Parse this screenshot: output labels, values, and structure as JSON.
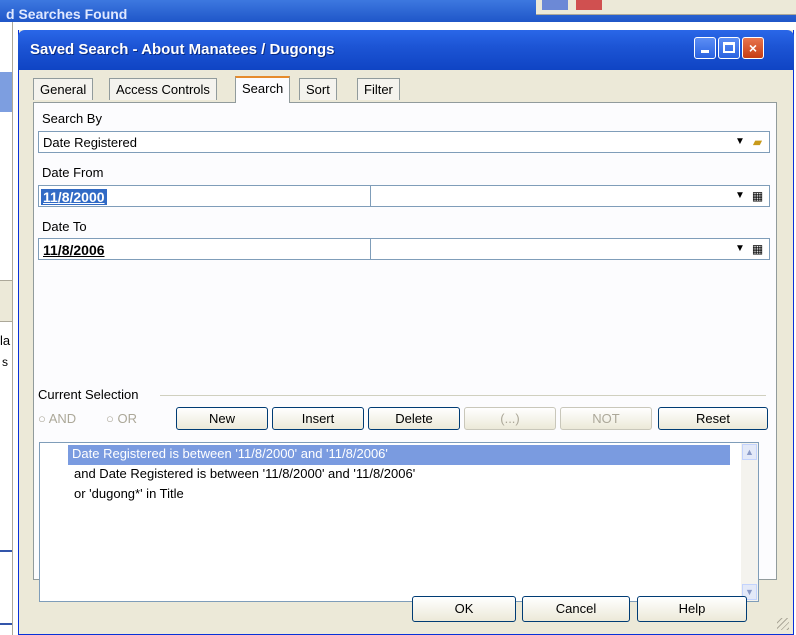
{
  "background": {
    "title_fragment": "d Searches Found",
    "left_text_1": "la",
    "left_text_2": "s"
  },
  "dialog": {
    "title": "Saved Search - About Manatees / Dugongs",
    "window_buttons": {
      "minimize": "minimize",
      "maximize": "maximize",
      "close": "×"
    }
  },
  "tabs": [
    "General",
    "Access Controls",
    "Search",
    "Sort",
    "Filter"
  ],
  "active_tab": "Search",
  "search_by": {
    "label": "Search By",
    "value": "Date Registered"
  },
  "date_from": {
    "label": "Date From",
    "value": "11/8/2000",
    "second_value": ""
  },
  "date_to": {
    "label": "Date To",
    "value": "11/8/2006",
    "second_value": ""
  },
  "current_selection": {
    "label": "Current Selection",
    "radio_and": "AND",
    "radio_or": "OR",
    "buttons": {
      "new": "New",
      "insert": "Insert",
      "delete": "Delete",
      "paren": "(...)",
      "not": "NOT",
      "reset": "Reset"
    },
    "items": [
      "Date Registered is between '11/8/2000' and '11/8/2006'",
      "and Date Registered is between '11/8/2000' and '11/8/2006'",
      "or 'dugong*' in Title"
    ],
    "selected_index": 0
  },
  "footer": {
    "ok": "OK",
    "cancel": "Cancel",
    "help": "Help"
  },
  "icons": {
    "dropdown": "chevron-down-icon",
    "open_folder": "folder-open-icon",
    "calendar": "calendar-icon"
  },
  "colors": {
    "title_bar": "#1d55d5",
    "selection": "#7a9be0",
    "dialog_bg": "#ece9d8"
  }
}
